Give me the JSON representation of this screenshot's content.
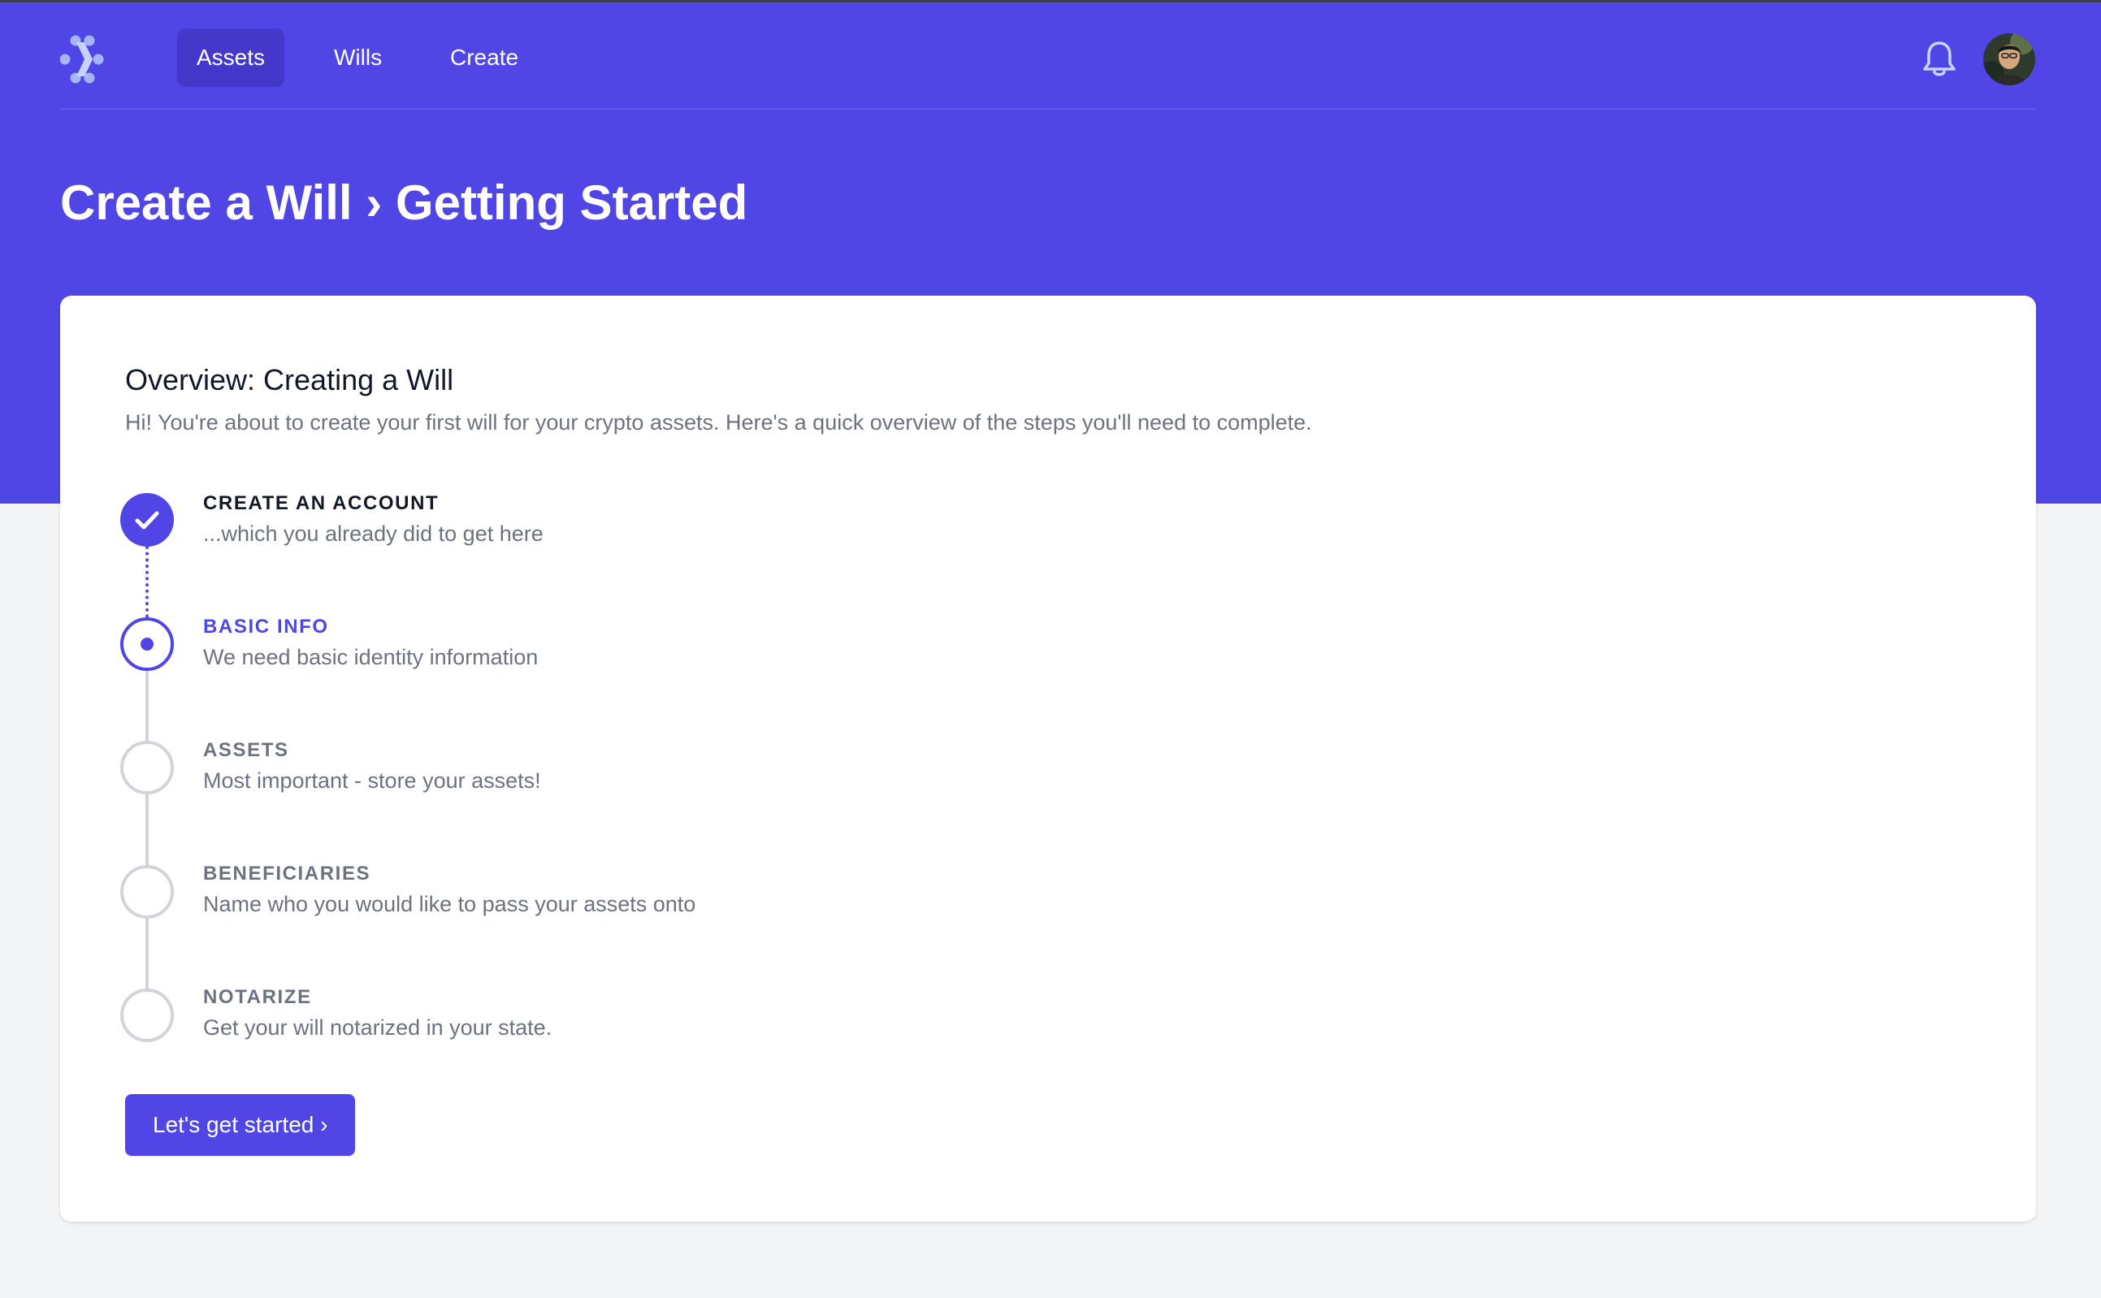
{
  "app": {
    "logo_icon": "dots-chevron-logo-icon",
    "brand_color": "#4f46e5",
    "active_nav_color": "#4338ca"
  },
  "nav": {
    "items": [
      {
        "label": "Assets",
        "active": true
      },
      {
        "label": "Wills",
        "active": false
      },
      {
        "label": "Create",
        "active": false
      }
    ],
    "notifications_icon": "bell-icon",
    "avatar_icon": "user-avatar-icon"
  },
  "header": {
    "title": "Create a Will › Getting Started"
  },
  "overview": {
    "title": "Overview: Creating a Will",
    "description": "Hi! You're about to create your first will for your crypto assets. Here's a quick overview of the steps you'll need to complete."
  },
  "steps": [
    {
      "name": "CREATE AN ACCOUNT",
      "description": "...which you already did to get here",
      "status": "complete",
      "icon": "check-icon"
    },
    {
      "name": "BASIC INFO",
      "description": "We need basic identity information",
      "status": "current",
      "icon": "current-step-dot-icon"
    },
    {
      "name": "ASSETS",
      "description": "Most important - store your assets!",
      "status": "upcoming",
      "icon": "empty-step-circle-icon"
    },
    {
      "name": "BENEFICIARIES",
      "description": "Name who you would like to pass your assets onto",
      "status": "upcoming",
      "icon": "empty-step-circle-icon"
    },
    {
      "name": "NOTARIZE",
      "description": "Get your will notarized in your state.",
      "status": "upcoming",
      "icon": "empty-step-circle-icon"
    }
  ],
  "actions": {
    "start_label": "Let's get started ›"
  }
}
